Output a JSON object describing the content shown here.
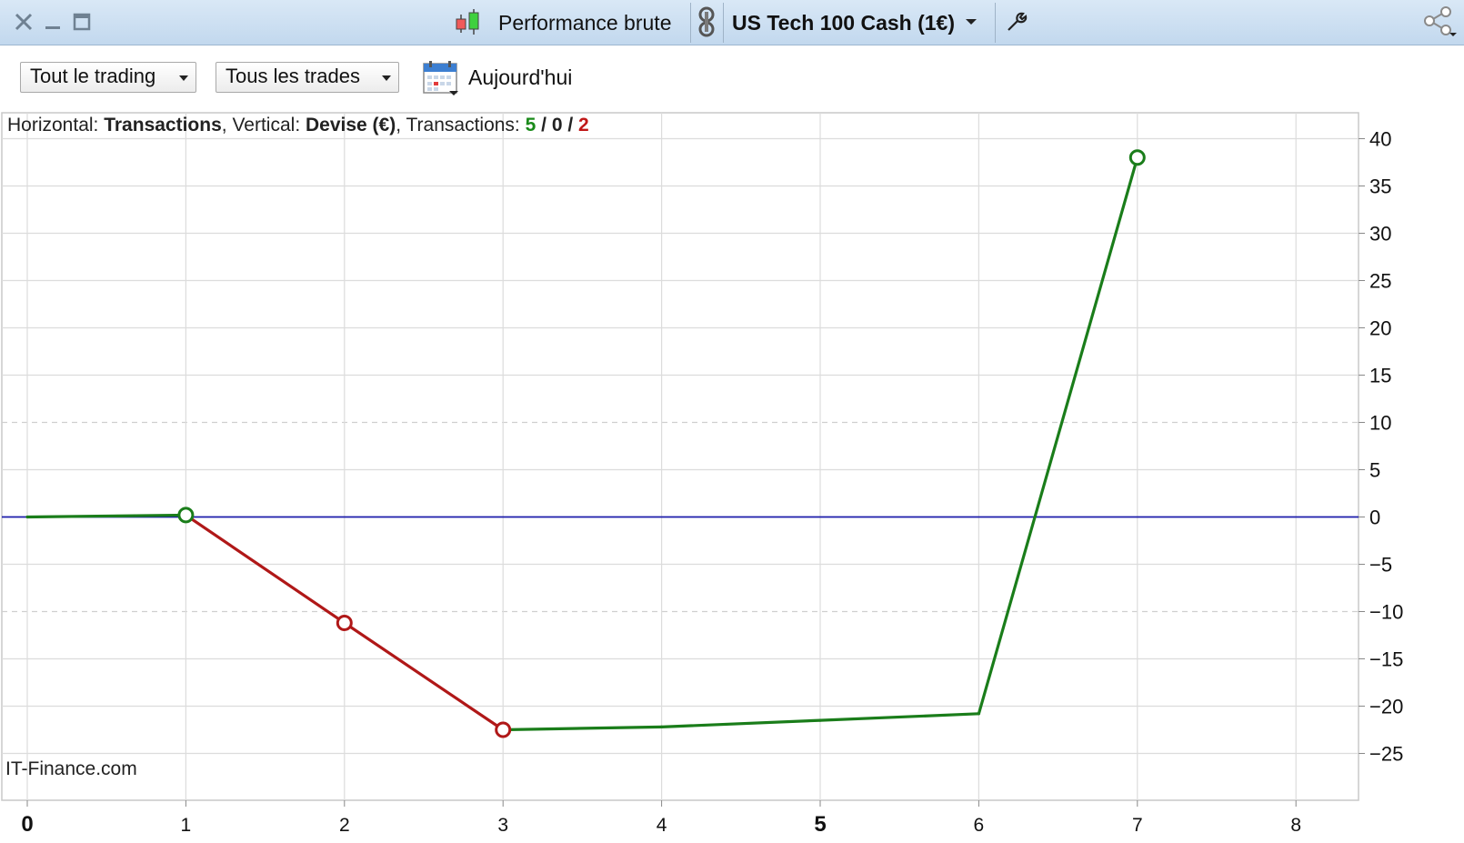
{
  "window": {
    "chart_type_label": "Performance brute",
    "instrument_label": "US Tech 100 Cash (1€)"
  },
  "toolbar": {
    "scope_dropdown": "Tout le trading",
    "trades_dropdown": "Tous les trades",
    "date_label": "Aujourd'hui"
  },
  "info": {
    "horizontal_prefix": "Horizontal: ",
    "horizontal_value": "Transactions",
    "vertical_prefix": ", Vertical: ",
    "vertical_value": "Devise (€)",
    "transactions_prefix": ", Transactions: ",
    "wins": "5",
    "sep1": " / ",
    "neutral": "0",
    "sep2": " / ",
    "losses": "2"
  },
  "watermark": "IT-Finance.com",
  "colors": {
    "gain": "#1a7d1a",
    "loss": "#b01818",
    "zero_line": "#1c1caa",
    "grid": "#dcdcdc"
  },
  "chart_data": {
    "type": "line",
    "x": [
      0,
      1,
      2,
      3,
      4,
      5,
      6,
      7
    ],
    "y": [
      0,
      0.2,
      -11.2,
      -22.5,
      -22.2,
      -21.5,
      -20.8,
      38
    ],
    "markers": [
      {
        "x": 1,
        "y": 0.2,
        "kind": "gain"
      },
      {
        "x": 2,
        "y": -11.2,
        "kind": "loss"
      },
      {
        "x": 3,
        "y": -22.5,
        "kind": "loss"
      },
      {
        "x": 7,
        "y": 38,
        "kind": "gain"
      }
    ],
    "segments": [
      {
        "from": 0,
        "to": 1,
        "kind": "gain"
      },
      {
        "from": 1,
        "to": 2,
        "kind": "loss"
      },
      {
        "from": 2,
        "to": 3,
        "kind": "loss"
      },
      {
        "from": 3,
        "to": 4,
        "kind": "gain"
      },
      {
        "from": 4,
        "to": 5,
        "kind": "gain"
      },
      {
        "from": 5,
        "to": 6,
        "kind": "gain"
      },
      {
        "from": 6,
        "to": 7,
        "kind": "gain"
      }
    ],
    "xlim": [
      0,
      8.4
    ],
    "ylim": [
      -28.5,
      44
    ],
    "xticks": [
      "0",
      "1",
      "2",
      "3",
      "4",
      "5",
      "6",
      "7",
      "8"
    ],
    "bold_xticks": [
      "0",
      "5"
    ],
    "yticks": [
      40,
      35,
      30,
      25,
      20,
      15,
      10,
      5,
      0,
      -5,
      -10,
      -15,
      -20,
      -25
    ],
    "dashed_gridlines_y": [
      10,
      -10
    ],
    "zero_line_y": 0,
    "grid": true
  }
}
